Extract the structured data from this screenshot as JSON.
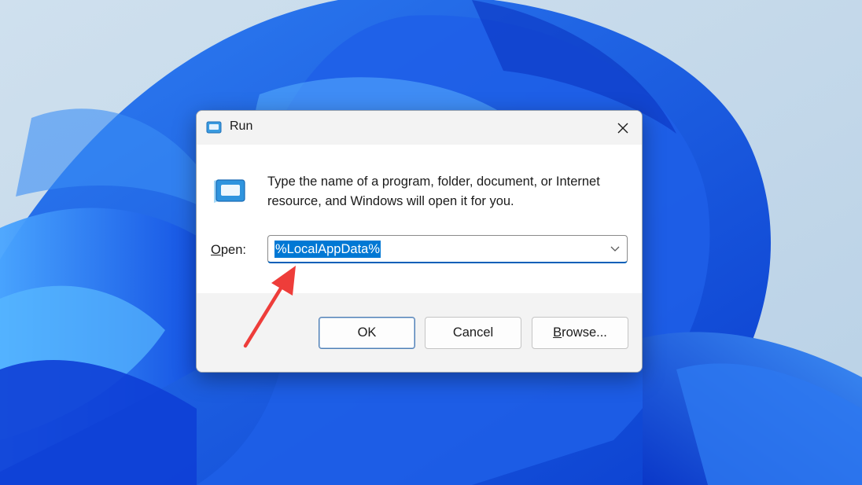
{
  "window": {
    "title": "Run",
    "title_icon": "run-app-icon",
    "close_icon": "close-icon"
  },
  "body": {
    "icon": "run-app-icon",
    "description": "Type the name of a program, folder, document, or Internet resource, and Windows will open it for you.",
    "open_label_prefix": "O",
    "open_label_rest": "pen:",
    "input_value": "%LocalAppData%",
    "dropdown_icon": "chevron-down-icon"
  },
  "buttons": {
    "ok": "OK",
    "cancel": "Cancel",
    "browse_prefix": "B",
    "browse_rest": "rowse..."
  },
  "colors": {
    "accent": "#0078d4",
    "annotation_arrow": "#ee3d3a"
  }
}
